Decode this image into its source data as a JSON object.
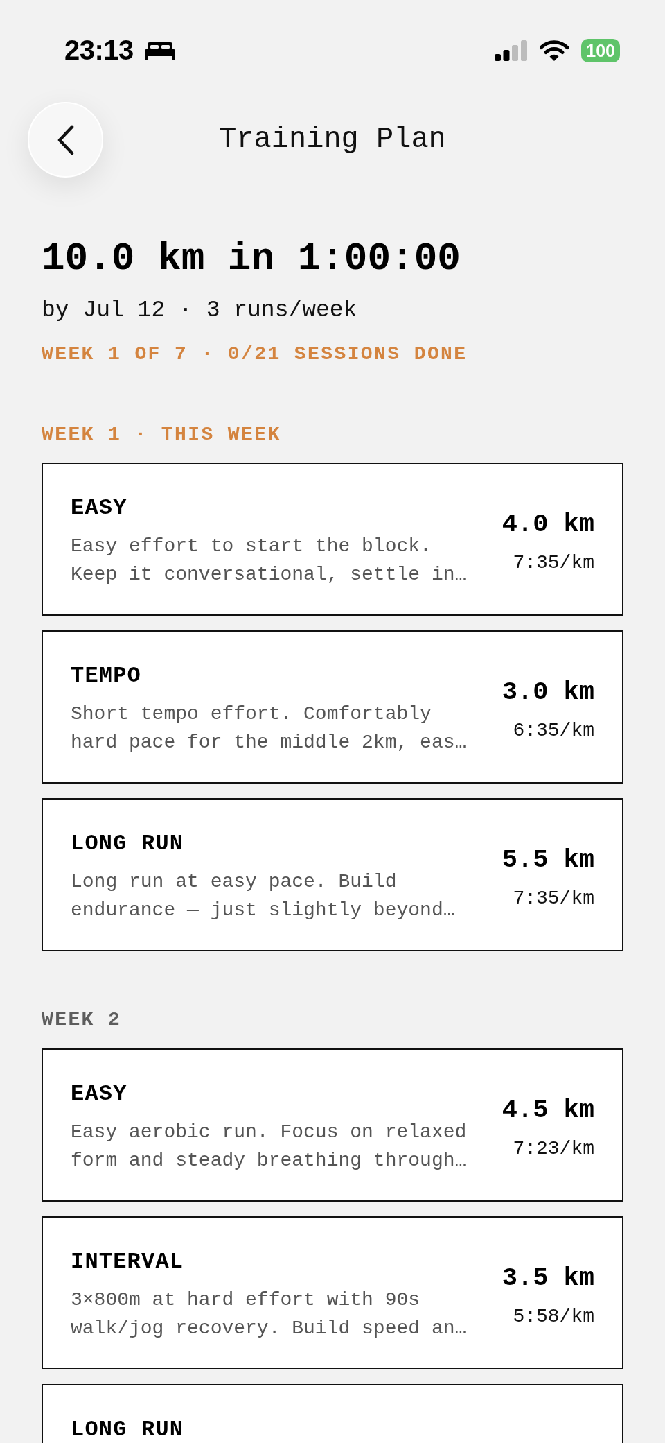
{
  "status_bar": {
    "time": "23:13",
    "battery": "100"
  },
  "header": {
    "title": "Training Plan"
  },
  "goal": {
    "title": "10.0 km in 1:00:00",
    "subtitle": "by Jul 12 · 3 runs/week",
    "progress": "WEEK 1 OF 7 · 0/21 SESSIONS DONE"
  },
  "weeks": [
    {
      "label": "WEEK 1 · THIS WEEK",
      "current": true,
      "sessions": [
        {
          "type": "EASY",
          "description": "Easy effort to start the block. Keep it conversational, settle in…",
          "distance": "4.0 km",
          "pace": "7:35/km"
        },
        {
          "type": "TEMPO",
          "description": "Short tempo effort. Comfortably hard pace for the middle 2km, eas…",
          "distance": "3.0 km",
          "pace": "6:35/km"
        },
        {
          "type": "LONG RUN",
          "description": "Long run at easy pace. Build endurance — just slightly beyond…",
          "distance": "5.5 km",
          "pace": "7:35/km"
        }
      ]
    },
    {
      "label": "WEEK 2",
      "current": false,
      "sessions": [
        {
          "type": "EASY",
          "description": "Easy aerobic run. Focus on relaxed form and steady breathing through…",
          "distance": "4.5 km",
          "pace": "7:23/km"
        },
        {
          "type": "INTERVAL",
          "description": "3×800m at hard effort with 90s walk/jog recovery. Build speed an…",
          "distance": "3.5 km",
          "pace": "5:58/km"
        },
        {
          "type": "LONG RUN"
        }
      ]
    }
  ]
}
